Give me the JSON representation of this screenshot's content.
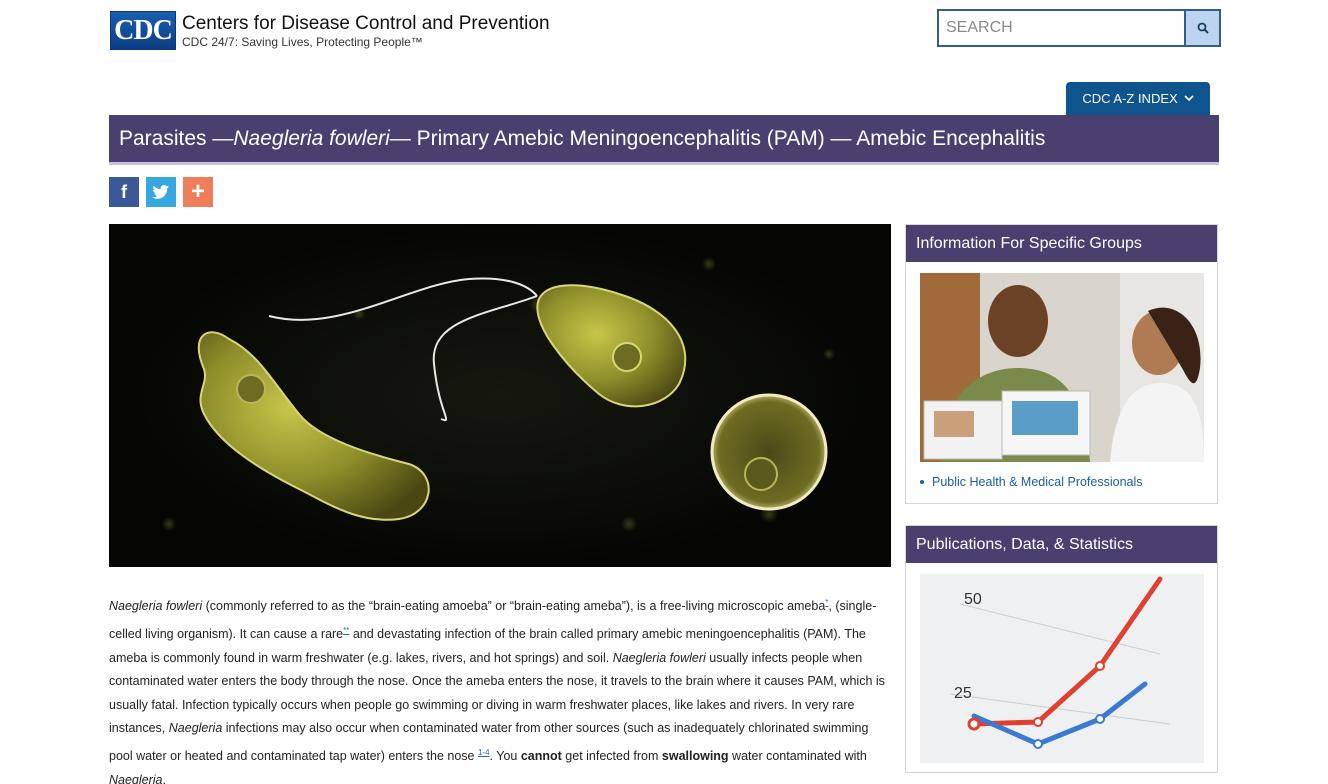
{
  "header": {
    "logo_mark": "CDC",
    "logo_title": "Centers for Disease Control and Prevention",
    "logo_tagline": "CDC 24/7: Saving Lives, Protecting People™",
    "search_placeholder": "SEARCH",
    "az_index_label": "CDC A-Z INDEX"
  },
  "page_title": {
    "prefix": "Parasites — ",
    "italic": "Naegleria fowleri",
    "suffix": " — Primary Amebic Meningoencephalitis (PAM) — Amebic Encephalitis"
  },
  "social": {
    "facebook": "f",
    "twitter_icon": "twitter-bird-icon",
    "share": "+"
  },
  "body": {
    "s1_italic": "Naegleria fowleri",
    "s1": " (commonly referred to as the “brain-eating amoeba” or “brain-eating ameba”), is a free-living microscopic ameba",
    "ref1": "*",
    "s2": ", (single-celled living organism). It can cause a rare",
    "ref2": "**",
    "s3": " and devastating infection of the brain called primary amebic meningoencephalitis (PAM). The ameba is commonly found in warm freshwater (e.g. lakes, rivers, and hot springs) and soil. ",
    "s3_italic": "Naegleria fowleri",
    "s4": " usually infects people when contaminated water enters the body through the nose. Once the ameba enters the nose, it travels to the brain where it causes PAM, which is usually fatal. Infection typically occurs when people go swimming or diving in warm freshwater places, like lakes and rivers. In very rare instances, ",
    "s4_italic": "Naegleria",
    "s5": " infections may also occur when contaminated water from other sources (such as inadequately chlorinated swimming pool water or heated and contaminated tap water) enters the nose ",
    "ref3": "1-4",
    "s6": ". You ",
    "s6_bold": "cannot",
    "s7": " get infected from ",
    "s7_bold": "swallowing",
    "s8": " water contaminated with ",
    "s8_italic": "Naegleria",
    "s9": "."
  },
  "sidebar": {
    "card1_title": "Information For Specific Groups",
    "card1_link": "Public Health & Medical Professionals",
    "card2_title": "Publications, Data, & Statistics",
    "chart_label_50": "50",
    "chart_label_25": "25"
  },
  "colors": {
    "brand_purple": "#4a3f6f",
    "link_blue": "#1a5fa0",
    "az_blue": "#10548d"
  }
}
